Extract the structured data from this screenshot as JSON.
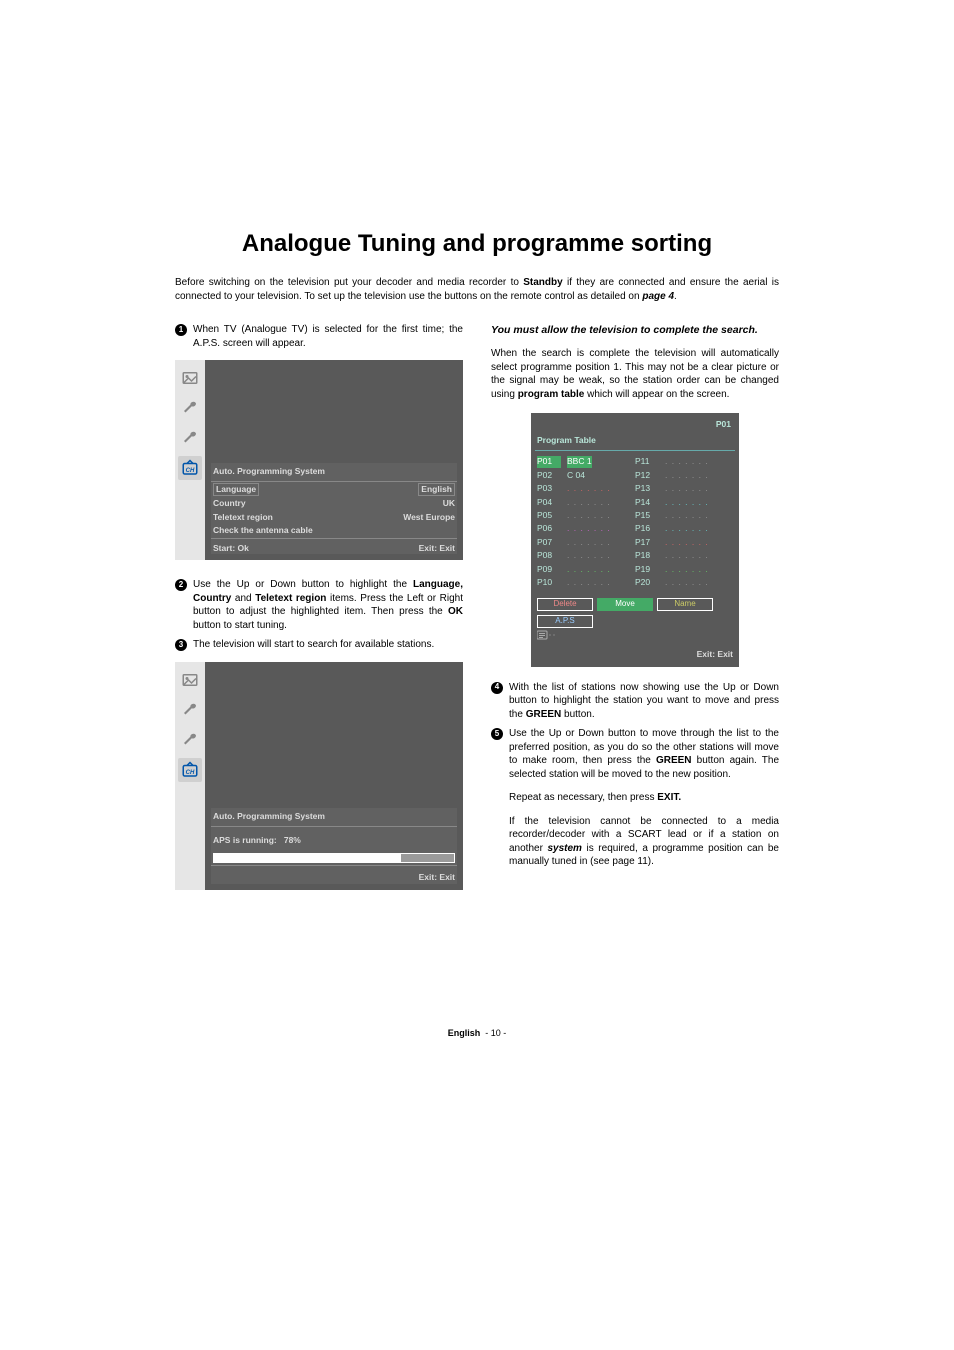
{
  "title": "Analogue Tuning and programme sorting",
  "intro": {
    "a": "Before switching on the television put your decoder and media recorder to ",
    "b": "Standby",
    "c": " if they are connected and ensure the aerial is connected to your television. To set up the television use the buttons on the remote control as detailed on ",
    "d": "page 4",
    "e": "."
  },
  "step1": "When TV (Analogue TV) is selected for the first time; the A.P.S. screen will appear.",
  "osd1": {
    "heading": "Auto. Programming System",
    "rows": [
      {
        "label": "Language",
        "value": "English"
      },
      {
        "label": "Country",
        "value": "UK"
      },
      {
        "label": "Teletext region",
        "value": "West Europe"
      }
    ],
    "note": "Check the antenna cable",
    "footerLeft": "Start: Ok",
    "footerRight": "Exit: Exit"
  },
  "step2": {
    "a": "Use the Up or Down button to highlight the ",
    "b": "Language, Country",
    "c": " and ",
    "d": "Teletext region",
    "e": " items. Press the Left or Right button to adjust the highlighted item. Then press the ",
    "f": "OK",
    "g": " button to start tuning."
  },
  "step3": "The television will start to search for available stations.",
  "osd2": {
    "heading": "Auto. Programming System",
    "statusLabel": "APS is running:",
    "statusValue": "78%",
    "footerRight": "Exit: Exit"
  },
  "right_top": "You must allow the television to complete the search.",
  "right_para": {
    "a": "When the search is complete the television will automatically select programme position 1. This may not be a clear picture or the signal may be weak, so the station order can be changed using ",
    "b": "program table",
    "c": " which will appear on the screen."
  },
  "pt": {
    "top": "P01",
    "title": "Program Table",
    "colA": [
      {
        "p": "P01",
        "v": "BBC  1",
        "hl": true
      },
      {
        "p": "P02",
        "v": "C   04"
      },
      {
        "p": "P03",
        "dots": true,
        "cls": "red"
      },
      {
        "p": "P04",
        "dots": true,
        "cls": "gry"
      },
      {
        "p": "P05",
        "dots": true,
        "cls": "gry"
      },
      {
        "p": "P06",
        "dots": true,
        "cls": "mag"
      },
      {
        "p": "P07",
        "dots": true,
        "cls": "gry"
      },
      {
        "p": "P08",
        "dots": true,
        "cls": "gry"
      },
      {
        "p": "P09",
        "dots": true,
        "cls": "grn"
      },
      {
        "p": "P10",
        "dots": true,
        "cls": "gry"
      }
    ],
    "colB": [
      {
        "p": "P11",
        "dots": true,
        "cls": "gry"
      },
      {
        "p": "P12",
        "dots": true,
        "cls": "gry"
      },
      {
        "p": "P13",
        "dots": true,
        "cls": "gry"
      },
      {
        "p": "P14",
        "dots": true,
        "cls": "cyan"
      },
      {
        "p": "P15",
        "dots": true,
        "cls": "gry"
      },
      {
        "p": "P16",
        "dots": true,
        "cls": "cyan"
      },
      {
        "p": "P17",
        "dots": true,
        "cls": "red"
      },
      {
        "p": "P18",
        "dots": true,
        "cls": "gry"
      },
      {
        "p": "P19",
        "dots": true,
        "cls": "grn"
      },
      {
        "p": "P20",
        "dots": true,
        "cls": "gry"
      }
    ],
    "btns": [
      {
        "label": "Delete",
        "cls": "red"
      },
      {
        "label": "Move",
        "cls": "green"
      },
      {
        "label": "Name",
        "cls": "yellow"
      },
      {
        "label": "A.P.S",
        "cls": "blue"
      }
    ],
    "footer": "Exit: Exit"
  },
  "step4": {
    "a": "With the list of stations now showing use the Up or Down button to highlight the station you want to move and press the ",
    "b": "GREEN",
    "c": " button."
  },
  "step5": {
    "a": "Use the Up or Down button to move through the list to the preferred position, as you do so the other stations will move to make room, then press the ",
    "b": "GREEN",
    "c": " button again. The selected station will be moved to the new position."
  },
  "repeat": {
    "a": "Repeat as necessary, then press ",
    "b": "EXIT."
  },
  "tail": {
    "a": "If the television cannot be connected to a media recorder/decoder with a SCART lead or if a station on another ",
    "b": "system",
    "c": " is required, a programme position can be manually tuned in (see page 11)."
  },
  "footer": {
    "lang": "English",
    "page": "- 10 -"
  }
}
